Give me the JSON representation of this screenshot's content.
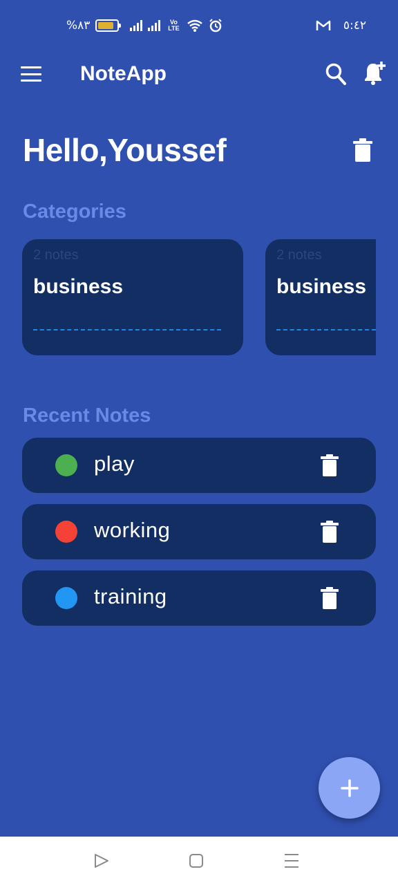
{
  "status_bar": {
    "battery_text": "%٨٣",
    "battery_level": 0.83,
    "volte_label": "Vo LTE",
    "carrier_icon": "gmail-icon",
    "time": "٥:٤٢"
  },
  "app_bar": {
    "title": "NoteApp"
  },
  "greeting": "Hello,Youssef",
  "categories": {
    "title": "Categories",
    "items": [
      {
        "count": "2 notes",
        "name": "business"
      },
      {
        "count": "2 notes",
        "name": "business"
      }
    ]
  },
  "recent_notes": {
    "title": "Recent Notes",
    "items": [
      {
        "label": "play",
        "color": "#4caf50"
      },
      {
        "label": "working",
        "color": "#f44336"
      },
      {
        "label": "training",
        "color": "#2196f3"
      }
    ]
  },
  "colors": {
    "background": "#3050b0",
    "card": "#132e62",
    "section_title": "#6b8ae6",
    "fab": "#8aa6f5"
  }
}
